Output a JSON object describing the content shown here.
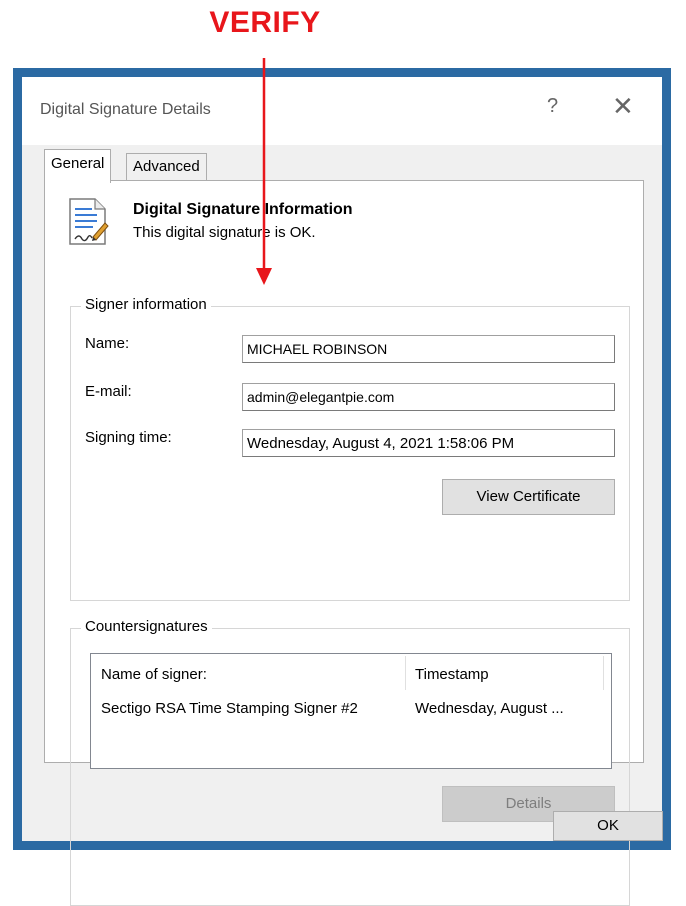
{
  "annotation": {
    "label": "VERIFY",
    "color": "#e8161b"
  },
  "window": {
    "title": "Digital Signature Details",
    "help_glyph": "?",
    "close_glyph": "✕",
    "frame_color": "#2b6aa3"
  },
  "tabs": [
    {
      "label": "General",
      "active": true
    },
    {
      "label": "Advanced",
      "active": false
    }
  ],
  "info": {
    "icon": "signed-document-icon",
    "title": "Digital Signature Information",
    "status": "This digital signature is OK."
  },
  "signer": {
    "legend": "Signer information",
    "name_label": "Name:",
    "name_value": "MICHAEL ROBINSON",
    "email_label": "E-mail:",
    "email_value": "admin@elegantpie.com",
    "time_label": "Signing time:",
    "time_value": "Wednesday, August 4, 2021 1:58:06 PM",
    "view_cert_label": "View Certificate"
  },
  "countersignatures": {
    "legend": "Countersignatures",
    "columns": [
      "Name of signer:",
      "Timestamp"
    ],
    "rows": [
      [
        "Sectigo RSA Time Stamping Signer #2",
        "Wednesday, August ..."
      ]
    ],
    "details_label": "Details"
  },
  "footer": {
    "ok_label": "OK"
  }
}
